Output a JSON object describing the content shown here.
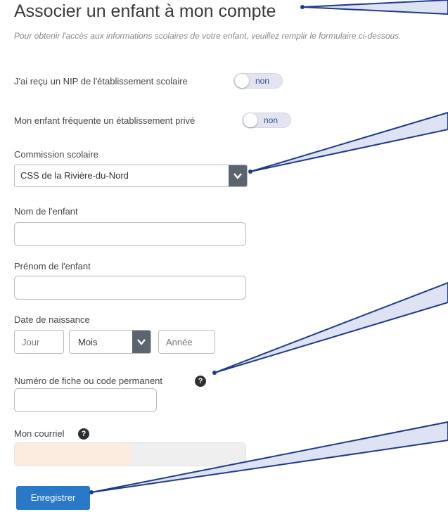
{
  "form": {
    "title": "Associer un enfant à mon compte",
    "intro": "Pour obtenir l'accès aux informations scolaires de votre enfant, veuillez remplir le formulaire ci-dessous.",
    "nip_label": "J'ai reçu un NIP de l'établissement scolaire",
    "nip_toggle": "non",
    "prive_label": "Mon enfant fréquente un établissement privé",
    "prive_toggle": "non",
    "commission_label": "Commission scolaire",
    "commission_value": "CSS de la Rivière-du-Nord",
    "nom_label": "Nom de l'enfant",
    "prenom_label": "Prénom de l'enfant",
    "naissance_label": "Date de naissance",
    "jour_placeholder": "Jour",
    "mois_value": "Mois",
    "annee_placeholder": "Année",
    "fiche_label": "Numéro de fiche ou code permanent",
    "courriel_label": "Mon courriel",
    "help_glyph": "?",
    "submit_label": "Enregistrer"
  },
  "icons": {
    "caret": "chevron-down-icon",
    "help": "question-circle-icon"
  },
  "colors": {
    "accent": "#2a78c8",
    "toggle_bg": "#e2e5ef",
    "toggle_text": "#2b4c9a",
    "arrow": "#1f3a8a",
    "caret_bg": "#5c6470"
  }
}
